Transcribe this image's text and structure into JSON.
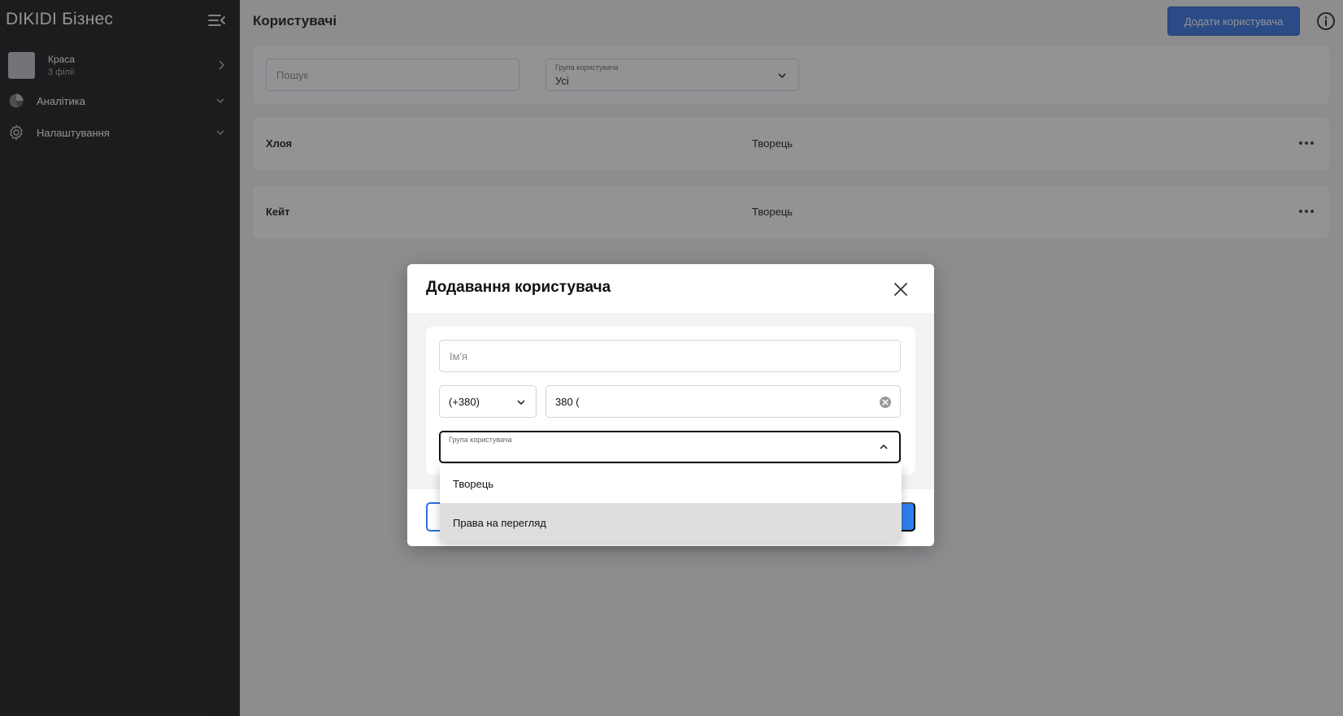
{
  "sidebar": {
    "brand": "DIKIDI Бізнес",
    "branch": {
      "name": "Краса",
      "subtitle": "3 філії"
    },
    "items": [
      {
        "label": "Аналітика",
        "icon": "pie-chart-icon"
      },
      {
        "label": "Налаштування",
        "icon": "gear-icon"
      }
    ]
  },
  "header": {
    "title": "Користувачі",
    "add_button": "Додати користувача"
  },
  "filters": {
    "search_placeholder": "Пошук",
    "group_label": "Група користувача",
    "group_value": "Усі"
  },
  "users": [
    {
      "name": "Хлоя",
      "role": "Творець"
    },
    {
      "name": "Кейт",
      "role": "Творець"
    }
  ],
  "modal": {
    "title": "Додавання користувача",
    "name_placeholder": "Ім'я",
    "country_code": "(+380)",
    "phone_value": "380 (",
    "group_label": "Група користувача",
    "dropdown_options": [
      {
        "label": "Творець"
      },
      {
        "label": "Права на перегляд"
      }
    ]
  },
  "colors": {
    "accent": "#2f6fe0",
    "sidebar_bg": "#111111"
  }
}
